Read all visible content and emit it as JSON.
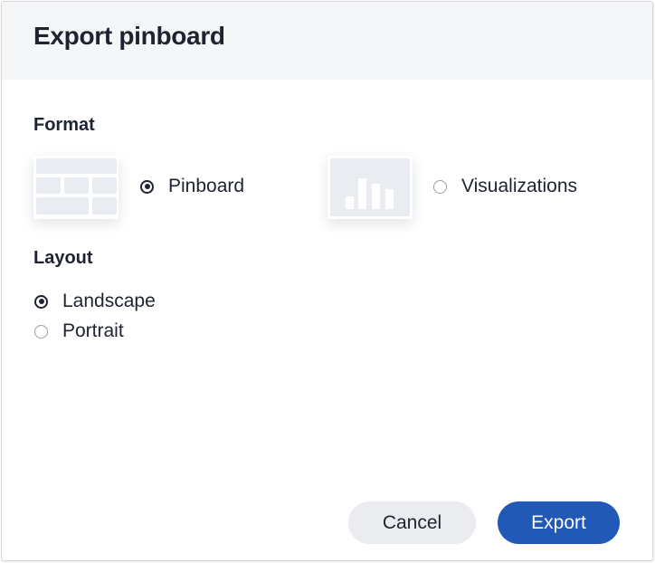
{
  "dialog": {
    "title": "Export pinboard",
    "format": {
      "label": "Format",
      "options": [
        {
          "label": "Pinboard",
          "selected": true,
          "thumbnail_icon": "pinboard-grid-icon"
        },
        {
          "label": "Visualizations",
          "selected": false,
          "thumbnail_icon": "bar-chart-icon"
        }
      ]
    },
    "layout": {
      "label": "Layout",
      "options": [
        {
          "label": "Landscape",
          "selected": true
        },
        {
          "label": "Portrait",
          "selected": false
        }
      ]
    },
    "buttons": {
      "cancel": "Cancel",
      "export": "Export"
    }
  },
  "colors": {
    "primary": "#2359b6",
    "header_bg": "#f5f6f7",
    "text": "#1d232f",
    "thumbnail_fill": "#e9ecf1"
  }
}
